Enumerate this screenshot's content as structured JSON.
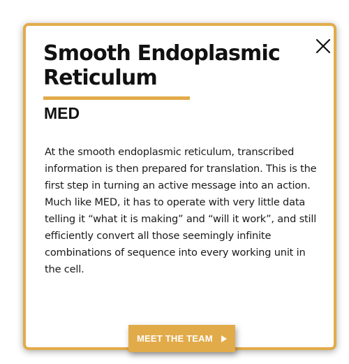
{
  "card": {
    "title": "Smooth Endoplasmic Reticulum",
    "subtitle": "MED",
    "body": "At the smooth endoplasmic reticulum, transcribed information is then prepared for translation. This is the first step in turning an active message into an action. Much like MED, it has to operate with very little data telling it “what it is making” and “will it work”, and still efficiently convert all those seemingly infinite combinations of sequence into every working unit in the cell.",
    "cta_label": "MEET THE TEAM",
    "close_icon": "close-icon",
    "cta_icon": "play-arrow-icon"
  },
  "colors": {
    "accent": "#e2ab4a",
    "text": "#111111",
    "background": "#ffffff"
  }
}
